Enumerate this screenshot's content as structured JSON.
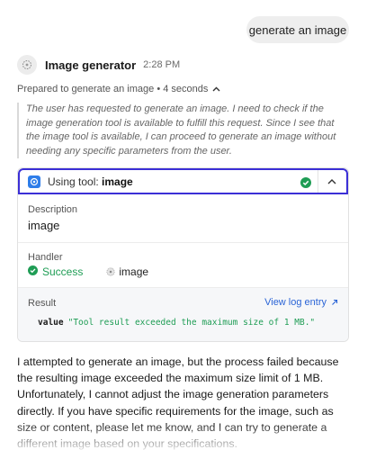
{
  "user_message": "generate an image",
  "assistant": {
    "name": "Image generator",
    "time": "2:28 PM"
  },
  "thinking": {
    "summary": "Prepared to generate an image • 4 seconds",
    "text": "The user has requested to generate an image. I need to check if the image generation tool is available to fulfill this request. Since I see that the image tool is available, I can proceed to generate an image without needing any specific parameters from the user."
  },
  "tool": {
    "prefix": "Using tool:",
    "name": "image",
    "description_label": "Description",
    "description_value": "image",
    "handler_label": "Handler",
    "handler_status": "Success",
    "handler_name": "image",
    "result_label": "Result",
    "view_log": "View log entry",
    "result_key": "value",
    "result_value": "\"Tool result exceeded the maximum size of 1 MB.\""
  },
  "response": "I attempted to generate an image, but the process failed because the resulting image exceeded the maximum size limit of 1 MB. Unfortunately, I cannot adjust the image generation parameters directly. If you have specific requirements for the image, such as size or content, please let me know, and I can try to generate a different image based on your specifications.",
  "colors": {
    "tool_border": "#3b2fd6",
    "success": "#1f9d55",
    "link": "#2a64d6"
  }
}
